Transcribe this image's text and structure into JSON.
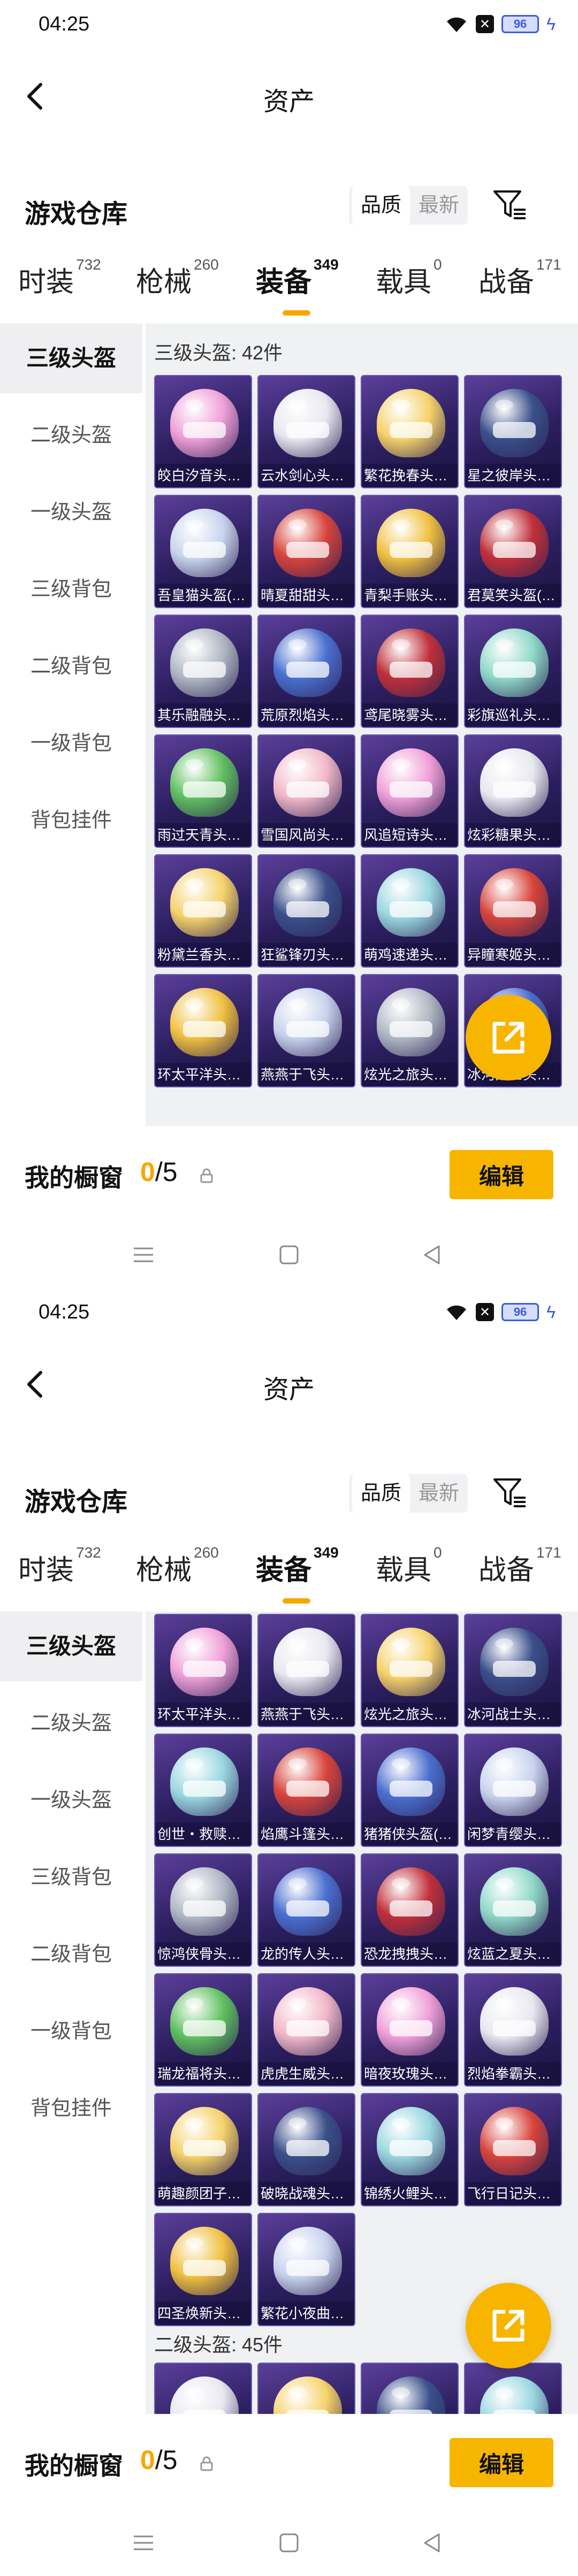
{
  "status": {
    "time": "04:25",
    "battery": "96"
  },
  "header": {
    "title": "资产"
  },
  "warehouse": {
    "title": "游戏仓库",
    "sort_quality": "品质",
    "sort_latest": "最新"
  },
  "tabs": [
    {
      "label": "时装",
      "count": "732"
    },
    {
      "label": "枪械",
      "count": "260"
    },
    {
      "label": "装备",
      "count": "349"
    },
    {
      "label": "载具",
      "count": "0"
    },
    {
      "label": "战备",
      "count": "171"
    }
  ],
  "active_tab": "装备",
  "sidebar": [
    {
      "label": "三级头盔"
    },
    {
      "label": "二级头盔"
    },
    {
      "label": "一级头盔"
    },
    {
      "label": "三级背包"
    },
    {
      "label": "二级背包"
    },
    {
      "label": "一级背包"
    },
    {
      "label": "背包挂件"
    }
  ],
  "screen1": {
    "section_title": "三级头盔: 42件",
    "items": [
      "皎白汐音头盔...",
      "云水剑心头盔...",
      "繁花挽春头盔...",
      "星之彼岸头盔...",
      "吾皇猫头盔(3...",
      "晴夏甜甜头盔...",
      "青梨手账头盔...",
      "君莫笑头盔(3...",
      "其乐融融头盔...",
      "荒原烈焰头盔...",
      "鸢尾晓雾头盔...",
      "彩旗巡礼头盔...",
      "雨过天青头盔...",
      "雪国风尚头盔...",
      "风追短诗头盔...",
      "炫彩糖果头盔...",
      "粉黛兰香头盔...",
      "狂鲨锋刃头盔...",
      "萌鸡速递头盔...",
      "异瞳寒姬头盔...",
      "环太平洋头盔...",
      "燕燕于飞头盔...",
      "炫光之旅头盔...",
      "冰河战士头盔..."
    ]
  },
  "screen2": {
    "items": [
      "环太平洋头盔...",
      "燕燕于飞头盔...",
      "炫光之旅头盔...",
      "冰河战士头盔...",
      "创世・救赎头...",
      "焰鹰斗篷头盔...",
      "猪猪侠头盔(3...",
      "闲梦青缨头盔...",
      "惊鸿侠骨头盔...",
      "龙的传人头盔...",
      "恐龙拽拽头盔...",
      "炫蓝之夏头盔...",
      "瑞龙福将头盔...",
      "虎虎生威头盔...",
      "暗夜玫瑰头盔...",
      "烈焰拳霸头盔...",
      "萌趣颜团子头...",
      "破晓战魂头盔...",
      "锦绣火鲤头盔...",
      "飞行日记头盔...",
      "四圣焕新头盔...",
      "繁花小夜曲头..."
    ],
    "next_section_title": "二级头盔: 45件"
  },
  "showcase": {
    "label": "我的橱窗",
    "current": "0",
    "total": "/5",
    "edit_label": "编辑"
  },
  "colors": {
    "accent": "#f7b500",
    "card_bg": "#3a2a78",
    "sidebar_active": "#efeff1"
  }
}
